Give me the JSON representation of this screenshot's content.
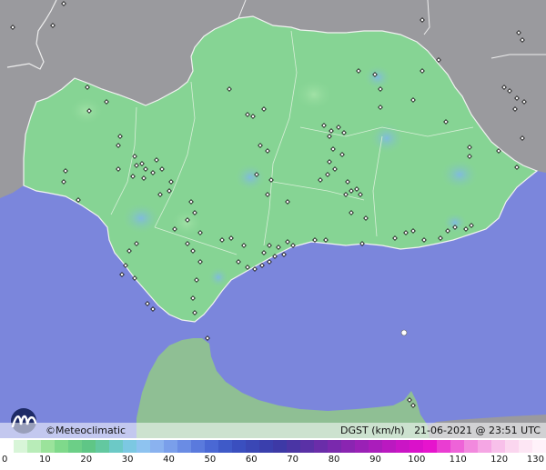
{
  "map": {
    "brand": "©Meteoclimatic",
    "variable": "DGST (km/h)",
    "datetime": "21-06-2021 @ 23:51 UTC",
    "colors": {
      "sea": "#7b86dc",
      "land_outside": "#9a9a9e",
      "region": "#86d494",
      "region_border": "#f2f2f2",
      "station": "#111111"
    }
  },
  "scale": {
    "ticks": [
      "0",
      "10",
      "20",
      "30",
      "40",
      "50",
      "60",
      "70",
      "80",
      "90",
      "100",
      "110",
      "120",
      "130"
    ],
    "colors": [
      "#ffffff",
      "#d8f5d8",
      "#b8ecb8",
      "#9be39b",
      "#7fd98b",
      "#6ccf87",
      "#5fc686",
      "#63c8a0",
      "#6cc9c6",
      "#7cc8e2",
      "#8ec3f0",
      "#8ab2ef",
      "#7a9fea",
      "#6a8ce4",
      "#5a7add",
      "#4a68d4",
      "#3f5ac8",
      "#3a4fbf",
      "#3a47b5",
      "#3a3fad",
      "#3d39a6",
      "#4a35a4",
      "#5a31a6",
      "#6a2da9",
      "#7a29ad",
      "#8a25b1",
      "#9a21b6",
      "#aa1dbb",
      "#ba19c0",
      "#ca15c5",
      "#da11ca",
      "#e614cd",
      "#ea3dd2",
      "#ee63d8",
      "#f289de",
      "#f5a6e4",
      "#f8c0ea",
      "#fbd6ef",
      "#fde6f4",
      "#fff2fa"
    ]
  }
}
